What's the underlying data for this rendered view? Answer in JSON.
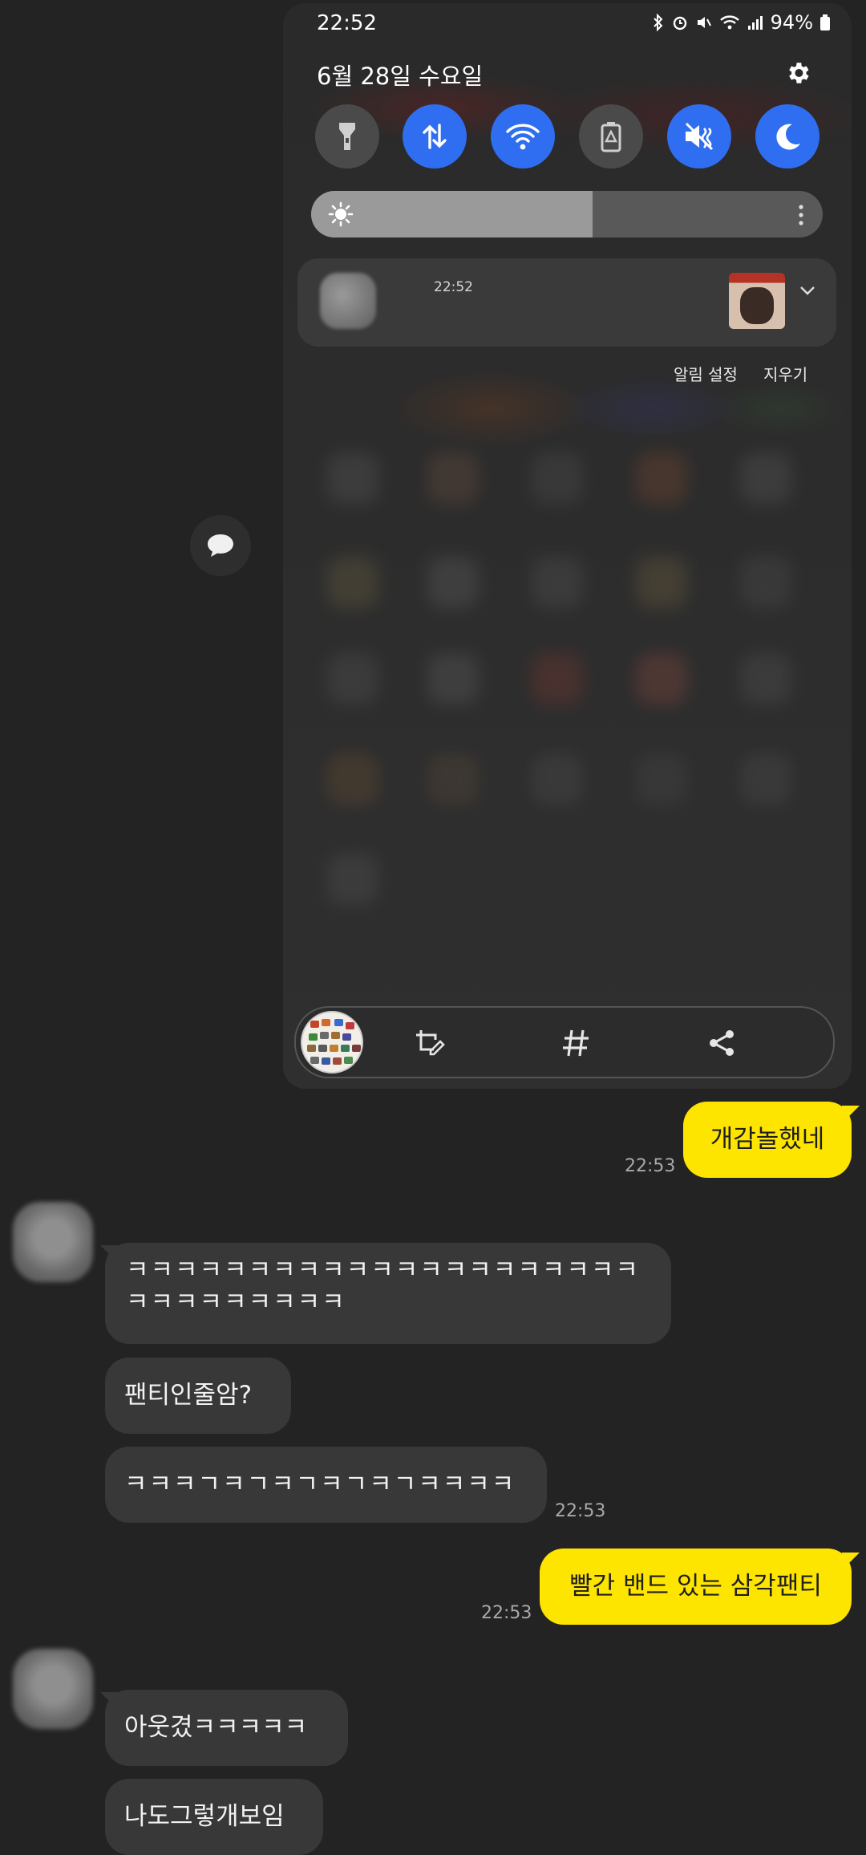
{
  "screenshot_card": {
    "status_time": "22:52",
    "battery_text": "94%",
    "date": "6월 28일 수요일",
    "notification_time": "22:52",
    "notification_settings": "알림 설정",
    "clear": "지우기",
    "brightness_level": 0.55,
    "quick_settings": [
      {
        "name": "flashlight",
        "state": "off"
      },
      {
        "name": "mobile-data",
        "state": "on"
      },
      {
        "name": "wifi",
        "state": "on"
      },
      {
        "name": "power-saving",
        "state": "off"
      },
      {
        "name": "mute",
        "state": "on"
      },
      {
        "name": "dark-mode",
        "state": "on"
      }
    ],
    "toolbar_icons": [
      "crop-edit-icon",
      "hashtag-icon",
      "share-icon"
    ]
  },
  "chat": {
    "messages": [
      {
        "from": "me",
        "text": "개감놀했네",
        "time": "22:53"
      },
      {
        "from": "them",
        "text": "ㅋㅋㅋㅋㅋㅋㅋㅋㅋㅋㅋㅋㅋㅋㅋㅋㅋㅋㅋㅋㅋㅋㅋㅋㅋㅋㅋㅋㅋㅋ"
      },
      {
        "from": "them",
        "text": "팬티인줄암?"
      },
      {
        "from": "them",
        "text": "ㅋㅋㅋㄱㅋㄱㅋㄱㅋㄱㅋㄱㅋㅋㅋㅋ",
        "time": "22:53"
      },
      {
        "from": "me",
        "text": "빨간 밴드 있는 삼각팬티",
        "time": "22:53"
      },
      {
        "from": "them",
        "text": "아웃겼ㅋㅋㅋㅋㅋ"
      },
      {
        "from": "them",
        "text": "나도그렇개보임"
      }
    ]
  },
  "colors": {
    "background": "#232323",
    "my_bubble": "#fee500",
    "their_bubble": "#383838",
    "toggle_on": "#2f6ef0"
  }
}
